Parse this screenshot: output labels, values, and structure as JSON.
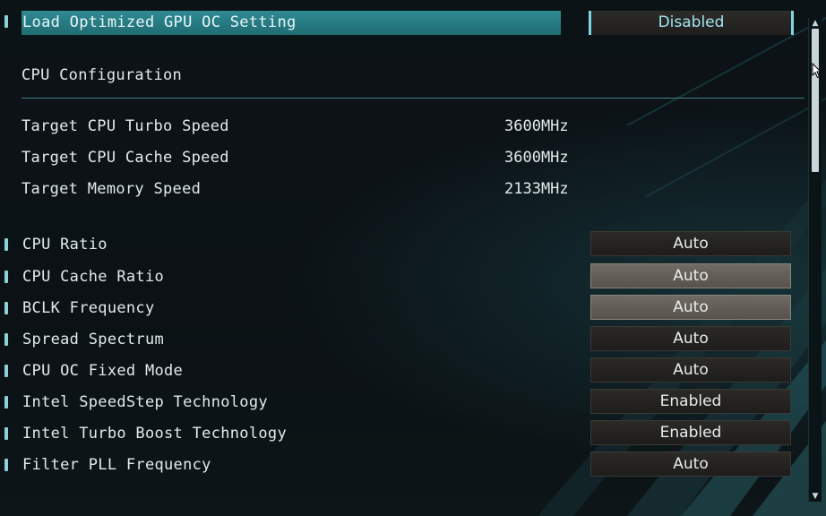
{
  "top_setting": {
    "label": "Load Optimized GPU OC Setting",
    "value": "Disabled"
  },
  "section_title": "CPU Configuration",
  "info": [
    {
      "label": "Target CPU Turbo Speed",
      "value": "3600MHz"
    },
    {
      "label": "Target CPU Cache Speed",
      "value": "3600MHz"
    },
    {
      "label": "Target Memory Speed",
      "value": "2133MHz"
    }
  ],
  "settings": [
    {
      "label": "CPU Ratio",
      "value": "Auto"
    },
    {
      "label": "CPU Cache Ratio",
      "value": "Auto"
    },
    {
      "label": "BCLK Frequency",
      "value": "Auto"
    },
    {
      "label": "Spread Spectrum",
      "value": "Auto"
    },
    {
      "label": "CPU OC Fixed Mode",
      "value": "Auto"
    },
    {
      "label": "Intel SpeedStep Technology",
      "value": "Enabled"
    },
    {
      "label": "Intel Turbo Boost Technology",
      "value": "Enabled"
    },
    {
      "label": "Filter PLL Frequency",
      "value": "Auto"
    }
  ],
  "scrollbar": {
    "up_icon": "▲",
    "down_icon": "▼"
  },
  "colors": {
    "accent": "#2f8a92",
    "selected_value_text": "#9fe6ee",
    "highlight_button": "#6f6a62"
  }
}
